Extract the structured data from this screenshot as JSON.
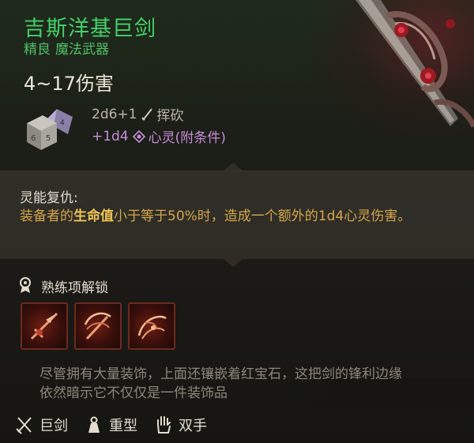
{
  "item": {
    "name": "吉斯洋基巨剑",
    "rarity": "精良",
    "category": "魔法武器",
    "damage_total": "4~17伤害",
    "damage_base": "2d6+1",
    "damage_base_type": "挥砍",
    "damage_bonus": "+1d4",
    "damage_bonus_type": "心灵(附条件)"
  },
  "passive": {
    "name": "灵能复仇:",
    "desc_part1": "装备者的",
    "desc_highlight": "生命值",
    "desc_part2": "小于等于50%时，造成一个额外的1d4心灵伤害。"
  },
  "proficiency": {
    "title": "熟练项解锁",
    "skills": [
      "skill-1",
      "skill-2",
      "skill-3"
    ]
  },
  "flavor": "尽管拥有大量装饰，上面还镶嵌着红宝石，这把剑的锋利边缘依然暗示它不仅仅是一件装饰品",
  "properties": [
    {
      "label": "巨剑",
      "icon": "crossed-swords-icon"
    },
    {
      "label": "重型",
      "icon": "weight-icon"
    },
    {
      "label": "双手",
      "icon": "hand-icon"
    }
  ],
  "colors": {
    "title": "#45d06a",
    "psychic": "#c88cd8",
    "passive_text": "#d6a64a",
    "highlight": "#f0c654"
  }
}
